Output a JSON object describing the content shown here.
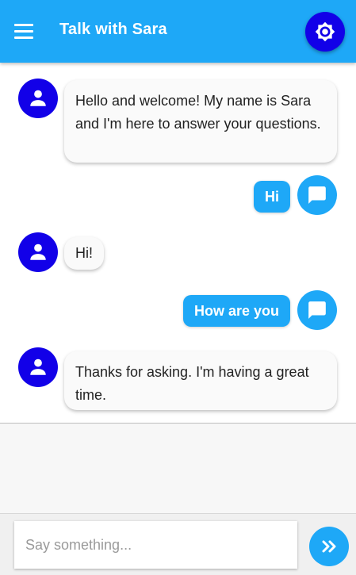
{
  "header": {
    "title": "Talk with Sara",
    "menu_icon": "hamburger-menu-icon",
    "theme_icon": "brightness-icon"
  },
  "colors": {
    "primary": "#1ea8f7",
    "accent": "#1200e8"
  },
  "messages": [
    {
      "from": "bot",
      "text": "Hello and welcome! My name is Sara and I'm here to answer your questions."
    },
    {
      "from": "user",
      "text": "Hi"
    },
    {
      "from": "bot",
      "text": "Hi!"
    },
    {
      "from": "user",
      "text": "How are you"
    },
    {
      "from": "bot",
      "text": "Thanks for asking. I'm having a great time."
    }
  ],
  "composer": {
    "placeholder": "Say something...",
    "send_icon": "double-chevron-right-icon"
  }
}
